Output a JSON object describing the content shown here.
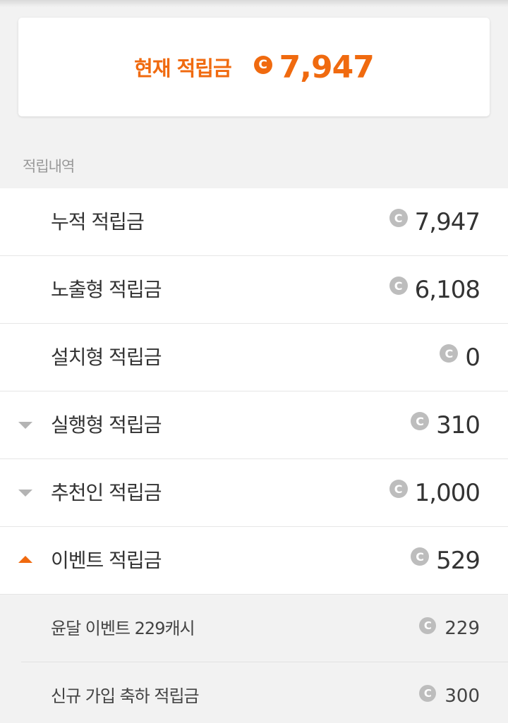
{
  "balance": {
    "label": "현재 적립금",
    "coin_symbol": "C",
    "value": "7,947",
    "accent_color": "#f06a0f"
  },
  "section": {
    "label": "적립내역"
  },
  "rows": [
    {
      "label": "누적 적립금",
      "coin_symbol": "C",
      "value": "7,947"
    },
    {
      "label": "노출형 적립금",
      "coin_symbol": "C",
      "value": "6,108"
    },
    {
      "label": "설치형 적립금",
      "coin_symbol": "C",
      "value": "0"
    },
    {
      "label": "실행형 적립금",
      "coin_symbol": "C",
      "value": "310",
      "expander": "collapsed"
    },
    {
      "label": "추천인 적립금",
      "coin_symbol": "C",
      "value": "1,000",
      "expander": "collapsed"
    },
    {
      "label": "이벤트 적립금",
      "coin_symbol": "C",
      "value": "529",
      "expander": "expanded"
    }
  ],
  "event_items": [
    {
      "label": "윤달 이벤트 229캐시",
      "coin_symbol": "C",
      "value": "229"
    },
    {
      "label": "신규 가입 축하 적립금",
      "coin_symbol": "C",
      "value": "300"
    }
  ]
}
